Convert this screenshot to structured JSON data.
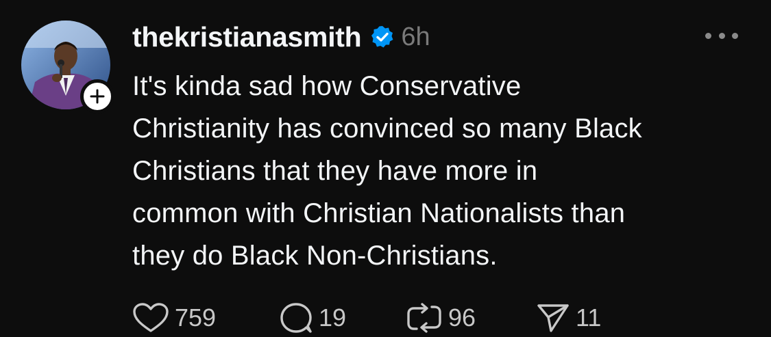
{
  "post": {
    "username": "thekristianasmith",
    "timestamp": "6h",
    "body_lines": [
      "It's kinda sad how Conservative",
      "Christianity has convinced so many Black",
      "Christians that they have more in",
      "common with Christian Nationalists than",
      "they do Black Non-Christians."
    ],
    "verified": true,
    "actions": {
      "likes": "759",
      "replies": "19",
      "reposts": "96",
      "shares": "11"
    }
  },
  "icons": {
    "verified": "verified-badge-icon",
    "more": "more-options-icon",
    "follow": "plus-icon",
    "like": "heart-icon",
    "reply": "comment-icon",
    "repost": "repost-icon",
    "share": "send-icon"
  },
  "colors": {
    "background": "#0d0d0d",
    "text": "#f3f5f7",
    "muted": "#7a7a7a",
    "verified": "#0095f6"
  }
}
